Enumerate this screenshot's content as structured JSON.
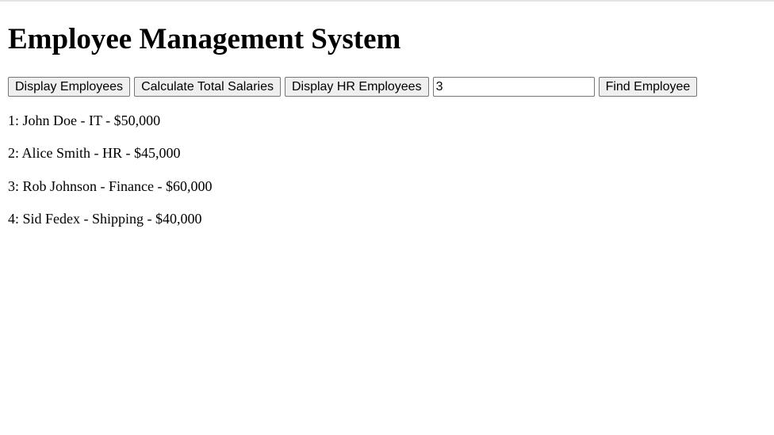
{
  "title": "Employee Management System",
  "toolbar": {
    "display_employees_label": "Display Employees",
    "calculate_total_label": "Calculate Total Salaries",
    "display_hr_label": "Display HR Employees",
    "employee_id_value": "3",
    "find_employee_label": "Find Employee"
  },
  "employees": [
    "1: John Doe - IT - $50,000",
    "2: Alice Smith - HR - $45,000",
    "3: Rob Johnson - Finance - $60,000",
    "4: Sid Fedex - Shipping - $40,000"
  ]
}
